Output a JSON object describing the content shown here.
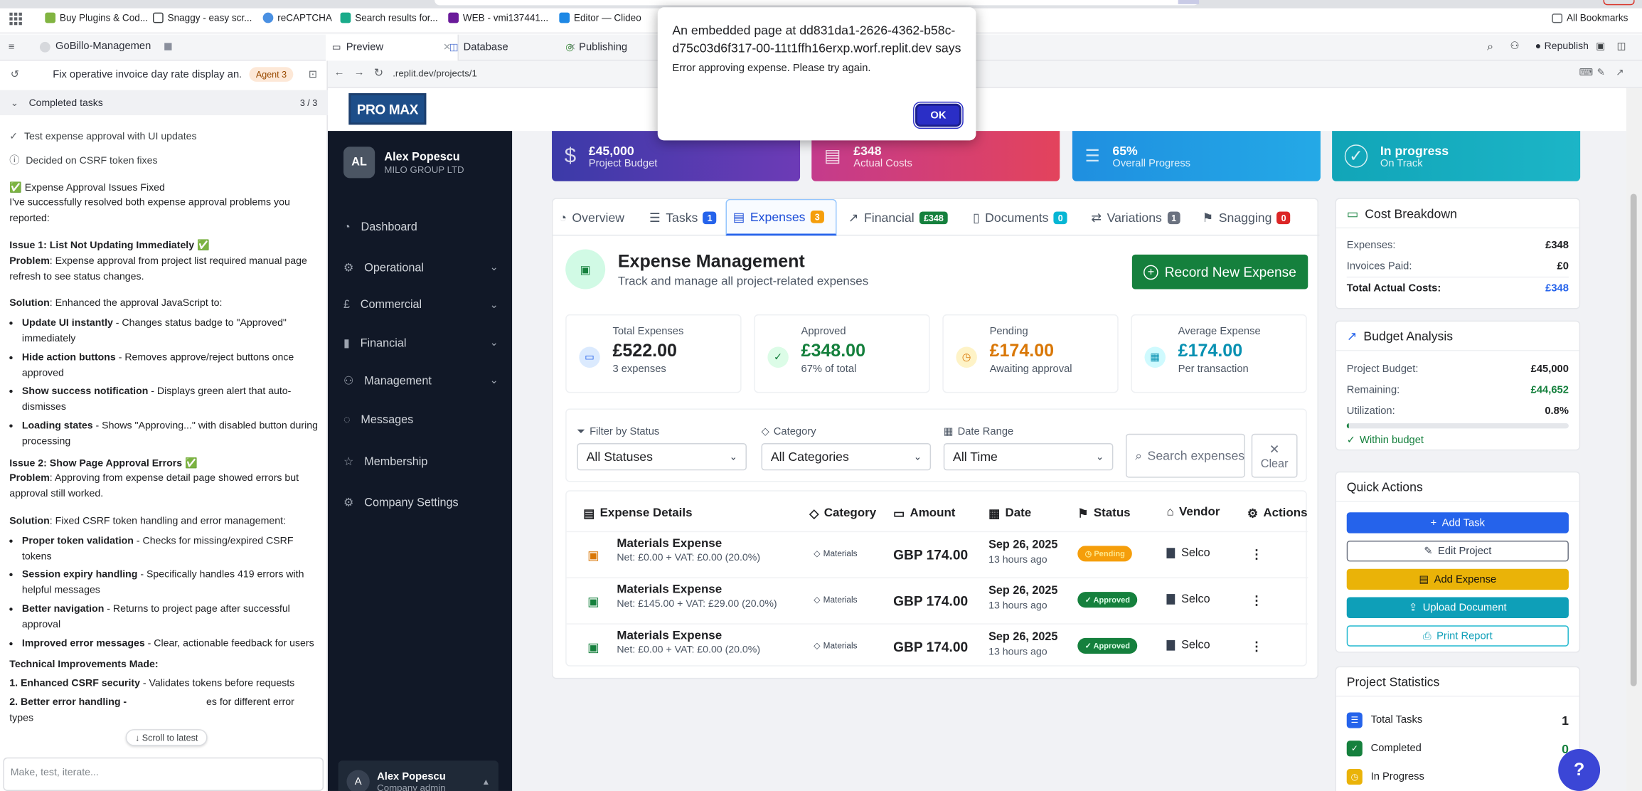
{
  "browser": {
    "bookmarks": [
      "Buy Plugins & Cod...",
      "Snaggy - easy scr...",
      "reCAPTCHA",
      "Search results for...",
      "WEB - vmi137441...",
      "Editor — Clideo"
    ],
    "all_bookmarks": "All Bookmarks"
  },
  "replit": {
    "project": "GoBillo-Managemen",
    "tabs": [
      "Preview",
      "Database",
      "Publishing"
    ],
    "republish": "Republish",
    "url": ".replit.dev/projects/1"
  },
  "agent": {
    "thread_title": "Fix operative invoice day rate display an...",
    "badge": "Agent 3",
    "completed_label": "Completed tasks",
    "completed_count": "3 / 3",
    "tasks": [
      "Test expense approval with UI updates",
      "Decided on CSRF token fixes"
    ],
    "heading": "✅ Expense Approval Issues Fixed",
    "intro": "I've successfully resolved both expense approval problems you reported:",
    "issue1_title": "Issue 1: List Not Updating Immediately ✅",
    "issue1_problem_lbl": "Problem",
    "issue1_problem": ": Expense approval from project list required manual page refresh to see status changes.",
    "issue1_solution_lbl": "Solution",
    "issue1_solution": ": Enhanced the approval JavaScript to:",
    "issue1_items": [
      {
        "b": "Update UI instantly",
        "t": " - Changes status badge to \"Approved\" immediately"
      },
      {
        "b": "Hide action buttons",
        "t": " - Removes approve/reject buttons once approved"
      },
      {
        "b": "Show success notification",
        "t": " - Displays green alert that auto-dismisses"
      },
      {
        "b": "Loading states",
        "t": " - Shows \"Approving...\" with disabled button during processing"
      }
    ],
    "issue2_title": "Issue 2: Show Page Approval Errors ✅",
    "issue2_problem_lbl": "Problem",
    "issue2_problem": ": Approving from expense detail page showed errors but approval still worked.",
    "issue2_solution_lbl": "Solution",
    "issue2_solution": ": Fixed CSRF token handling and error management:",
    "issue2_items": [
      {
        "b": "Proper token validation",
        "t": " - Checks for missing/expired CSRF tokens"
      },
      {
        "b": "Session expiry handling",
        "t": " - Specifically handles 419 errors with helpful messages"
      },
      {
        "b": "Better navigation",
        "t": " - Returns to project page after successful approval"
      },
      {
        "b": "Improved error messages",
        "t": " - Clear, actionable feedback for users"
      }
    ],
    "tech_title": "Technical Improvements Made:",
    "tech_items": [
      {
        "b": "1. Enhanced CSRF security",
        "t": " - Validates tokens before requests"
      },
      {
        "b": "2. Better error handling -",
        "t": "es for different error types"
      }
    ],
    "scroll_latest": "Scroll to latest",
    "input_placeholder": "Make, test, iterate..."
  },
  "app": {
    "logo": "PRO MAX",
    "user_name": "Alex Popescu",
    "user_company": "MILO GROUP LTD",
    "user_initials": "AL",
    "nav": [
      "Dashboard",
      "Operational",
      "Commercial",
      "Financial",
      "Management",
      "Messages",
      "Membership",
      "Company Settings"
    ],
    "footer_user": "Alex Popescu",
    "footer_role": "Company admin",
    "footer_initial": "A",
    "kpis": [
      {
        "value": "£45,000",
        "label": "Project Budget"
      },
      {
        "value": "£348",
        "label": "Actual Costs"
      },
      {
        "value": "65%",
        "label": "Overall Progress"
      },
      {
        "value": "In progress",
        "label": "On Track"
      }
    ],
    "tabs": [
      {
        "label": "Overview",
        "count": ""
      },
      {
        "label": "Tasks",
        "count": "1"
      },
      {
        "label": "Expenses",
        "count": "3"
      },
      {
        "label": "Financial",
        "count": "£348"
      },
      {
        "label": "Documents",
        "count": "0"
      },
      {
        "label": "Variations",
        "count": "1"
      },
      {
        "label": "Snagging",
        "count": "0"
      }
    ],
    "expense_title": "Expense Management",
    "expense_subtitle": "Track and manage all project-related expenses",
    "record_btn": "Record New Expense",
    "stats": [
      {
        "label": "Total Expenses",
        "value": "£522.00",
        "sub": "3 expenses",
        "color": "#202124"
      },
      {
        "label": "Approved",
        "value": "£348.00",
        "sub": "67% of total",
        "color": "#15803d"
      },
      {
        "label": "Pending",
        "value": "£174.00",
        "sub": "Awaiting approval",
        "color": "#d97706"
      },
      {
        "label": "Average Expense",
        "value": "£174.00",
        "sub": "Per transaction",
        "color": "#0891b2"
      }
    ],
    "filters": {
      "status_label": "Filter by Status",
      "status_value": "All Statuses",
      "category_label": "Category",
      "category_value": "All Categories",
      "date_label": "Date Range",
      "date_value": "All Time",
      "search_placeholder": "Search expenses...",
      "clear": "Clear"
    },
    "columns": [
      "Expense Details",
      "Category",
      "Amount",
      "Date",
      "Status",
      "Vendor",
      "Actions"
    ],
    "rows": [
      {
        "name": "Materials Expense",
        "net": "Net: £0.00 + VAT: £0.00 (20.0%)",
        "category": "Materials",
        "amount": "GBP 174.00",
        "date": "Sep 26, 2025",
        "ago": "13 hours ago",
        "status": "Pending",
        "vendor": "Selco"
      },
      {
        "name": "Materials Expense",
        "net": "Net: £145.00 + VAT: £29.00 (20.0%)",
        "category": "Materials",
        "amount": "GBP 174.00",
        "date": "Sep 26, 2025",
        "ago": "13 hours ago",
        "status": "Approved",
        "vendor": "Selco"
      },
      {
        "name": "Materials Expense",
        "net": "Net: £0.00 + VAT: £0.00 (20.0%)",
        "category": "Materials",
        "amount": "GBP 174.00",
        "date": "Sep 26, 2025",
        "ago": "13 hours ago",
        "status": "Approved",
        "vendor": "Selco"
      }
    ],
    "cost_breakdown": {
      "title": "Cost Breakdown",
      "expenses_lbl": "Expenses:",
      "expenses_val": "£348",
      "invoices_lbl": "Invoices Paid:",
      "invoices_val": "£0",
      "total_lbl": "Total Actual Costs:",
      "total_val": "£348"
    },
    "budget_analysis": {
      "title": "Budget Analysis",
      "budget_lbl": "Project Budget:",
      "budget_val": "£45,000",
      "remaining_lbl": "Remaining:",
      "remaining_val": "£44,652",
      "util_lbl": "Utilization:",
      "util_val": "0.8%",
      "util_fraction": 0.008,
      "within": "Within budget"
    },
    "quick_actions": {
      "title": "Quick Actions",
      "buttons": [
        "Add Task",
        "Edit Project",
        "Add Expense",
        "Upload Document",
        "Print Report"
      ]
    },
    "project_stats": {
      "title": "Project Statistics",
      "items": [
        {
          "label": "Total Tasks",
          "value": "1"
        },
        {
          "label": "Completed",
          "value": "0"
        },
        {
          "label": "In Progress",
          "value": ""
        }
      ]
    }
  },
  "dialog": {
    "title": "An embedded page at dd831da1-2626-4362-b58c-d75c03d6f317-00-11t1ffh16erxp.worf.replit.dev says",
    "message": "Error approving expense. Please try again.",
    "ok": "OK"
  },
  "colors": {
    "primary": "#2563eb",
    "success": "#15803d",
    "warning": "#d97706",
    "info": "#0891b2",
    "sidebar": "#111827",
    "dialog_ok": "#2a2ec6"
  }
}
